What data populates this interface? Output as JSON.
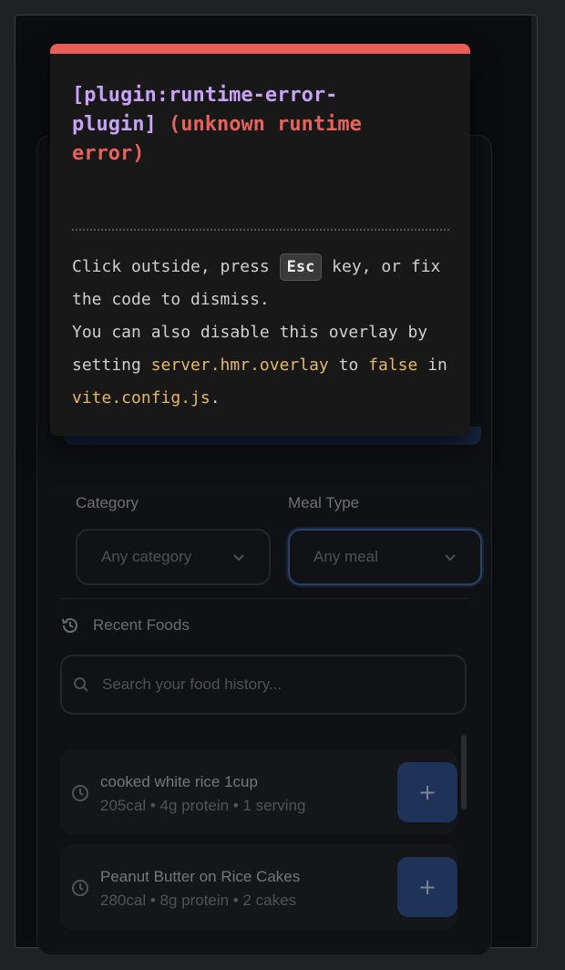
{
  "overlay": {
    "plugin": "[plugin:runtime-error-plugin]",
    "message": "(unknown runtime error)",
    "tip_part1": "Click outside, press",
    "tip_key": "Esc",
    "tip_part2": "key, or fix the code to dismiss.",
    "tip_line2_part1": "You can also disable this overlay by setting",
    "tip_code1": "server.hmr.overlay",
    "tip_line2_part2": "to",
    "tip_code2": "false",
    "tip_line2_part3": "in",
    "tip_code3": "vite.config.js",
    "tip_line2_end": "."
  },
  "filters": {
    "category_label": "Category",
    "category_value": "Any category",
    "meal_label": "Meal Type",
    "meal_value": "Any meal"
  },
  "recent": {
    "title": "Recent Foods",
    "search_placeholder": "Search your food history...",
    "items": [
      {
        "name": "cooked white rice 1cup",
        "meta": "205cal • 4g protein • 1 serving"
      },
      {
        "name": "Peanut Butter on Rice Cakes",
        "meta": "280cal • 8g protein • 2 cakes"
      }
    ],
    "add_label": "+"
  },
  "colors": {
    "overlay_accent": "#e85d55",
    "plugin_color": "#c7a2f5",
    "code_color": "#e6b866"
  }
}
